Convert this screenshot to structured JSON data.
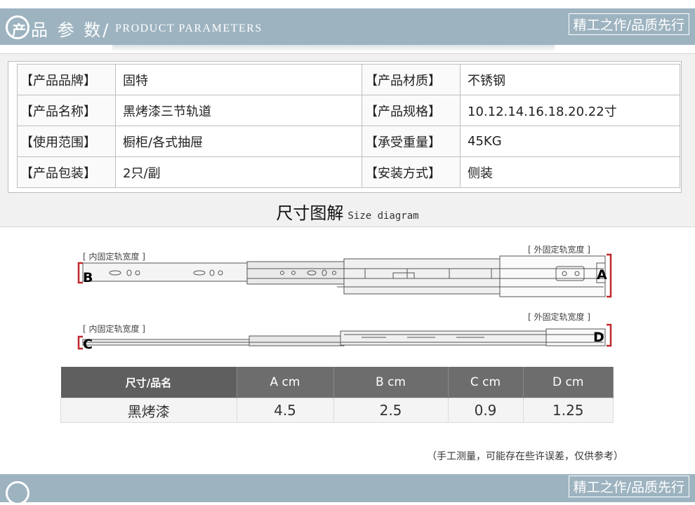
{
  "header": {
    "title_cn": "品 参 数/",
    "logo_char": "产",
    "title_en": "PRODUCT PARAMETERS",
    "slogan": "精工之作/品质先行"
  },
  "params": {
    "rows": [
      {
        "k1": "【产品品牌】",
        "v1": "固特",
        "k2": "【产品材质】",
        "v2": "不锈钢"
      },
      {
        "k1": "【产品名称】",
        "v1": "黑烤漆三节轨道",
        "k2": "【产品规格】",
        "v2": "10.12.14.16.18.20.22寸"
      },
      {
        "k1": "【使用范围】",
        "v1": "橱柜/各式抽屉",
        "k2": "【承受重量】",
        "v2": "45KG"
      },
      {
        "k1": "【产品包装】",
        "v1": "2只/副",
        "k2": "【安装方式】",
        "v2": "侧装"
      }
    ]
  },
  "size_diagram": {
    "title": "尺寸图解",
    "subtitle": "Size diagram",
    "inner_label_1": "[ 内固定轨宽度 ]",
    "outer_label_1": "[ 外固定轨宽度 ]",
    "inner_label_2": "[ 内固定轨宽度 ]",
    "outer_label_2": "[ 外固定轨宽度 ]",
    "letter_a": "A",
    "letter_b": "B",
    "letter_c": "C",
    "letter_d": "D",
    "bracket_color": "#c0282d"
  },
  "size_table": {
    "headers": [
      "尺寸/品名",
      "A cm",
      "B cm",
      "C cm",
      "D cm"
    ],
    "row": [
      "黑烤漆",
      "4.5",
      "2.5",
      "0.9",
      "1.25"
    ]
  },
  "note": "（手工测量，可能存在些许误差，仅供参考）",
  "footer": {
    "slogan": "精工之作/品质先行"
  }
}
